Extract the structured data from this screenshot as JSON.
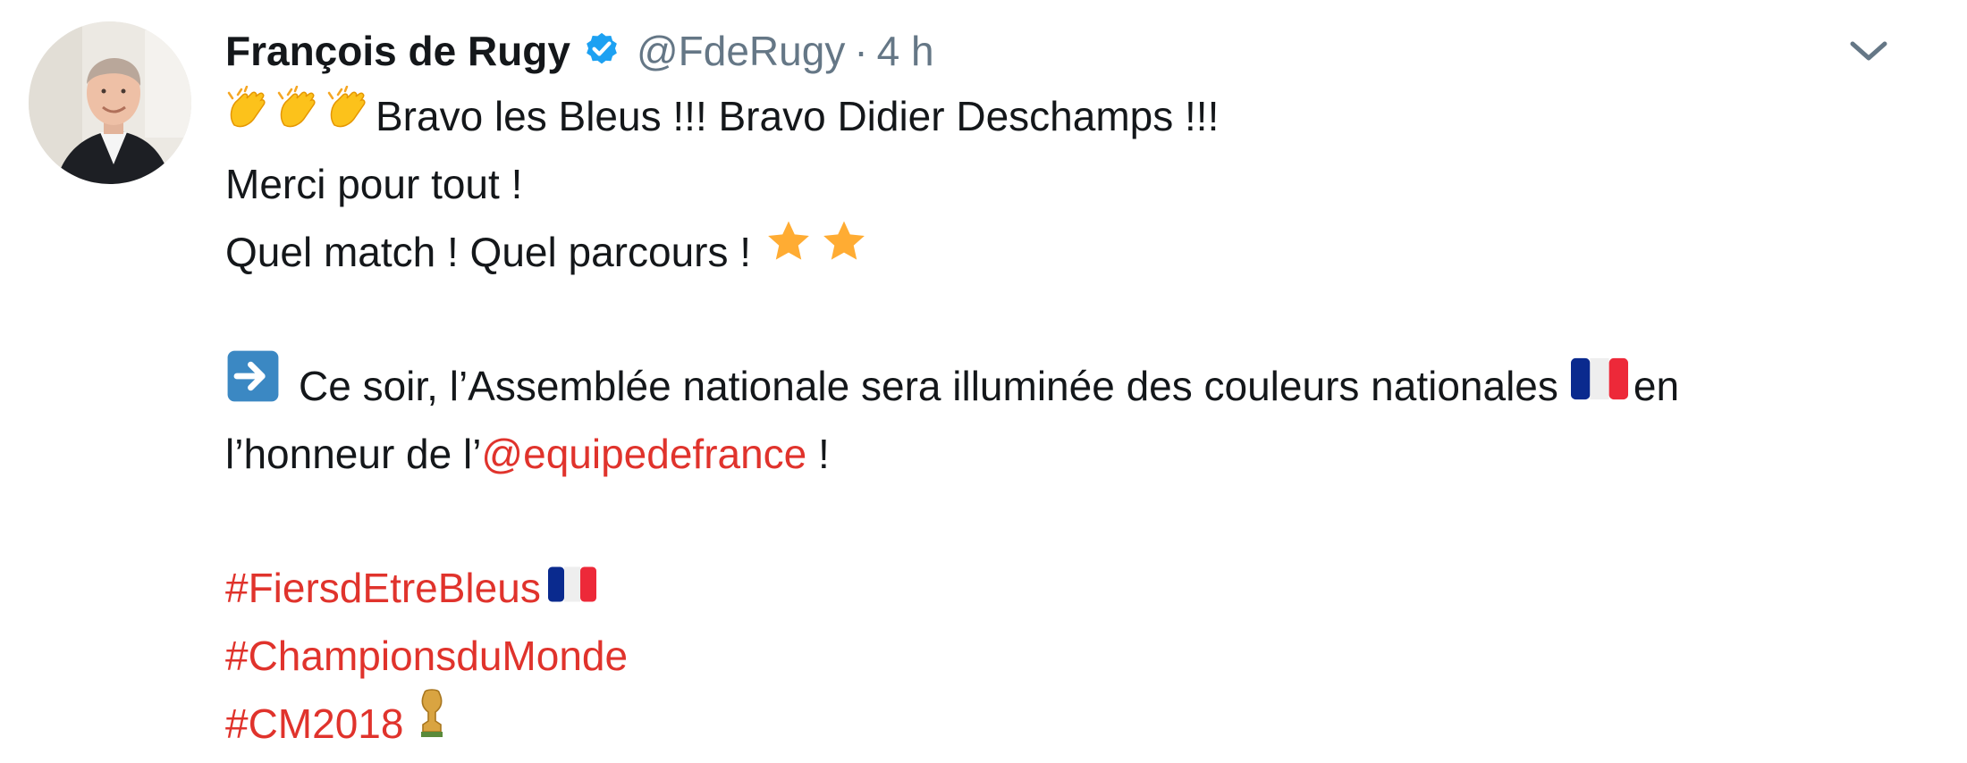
{
  "tweet": {
    "author_name": "François de Rugy",
    "handle": "@FdeRugy",
    "separator": "·",
    "time": "4 h",
    "lines": {
      "l1_text": "Bravo les Bleus !!! Bravo Didier Deschamps !!!",
      "l2_text": "Merci pour tout !",
      "l3_text": "Quel match ! Quel parcours !",
      "l4_text": "Ce soir, l’Assemblée nationale sera illuminée des couleurs nationales",
      "l4_suffix": "en",
      "l5_prefix": "l’honneur de l’",
      "l5_mention": "@equipedefrance",
      "l5_suffix": " !",
      "hashtag1": "#FiersdEtreBleus",
      "hashtag2": "#ChampionsduMonde",
      "hashtag3": "#CM2018"
    },
    "icons": {
      "verified": "verified-badge-icon",
      "caret": "chevron-down-icon",
      "clap": "clapping-hands-emoji",
      "star": "star-emoji",
      "arrow": "right-arrow-emoji",
      "flag": "france-flag-emoji",
      "trophy": "trophy-emoji"
    },
    "colors": {
      "link": "#e0332c",
      "verified": "#1da1f2",
      "muted": "#657786",
      "text": "#14171a"
    }
  }
}
